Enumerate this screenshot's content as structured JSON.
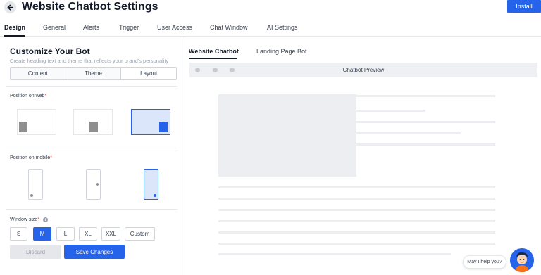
{
  "header": {
    "title": "Website Chatbot Settings",
    "install_label": "Install"
  },
  "tabs": [
    {
      "label": "Design",
      "active": true
    },
    {
      "label": "General"
    },
    {
      "label": "Alerts"
    },
    {
      "label": "Trigger"
    },
    {
      "label": "User Access"
    },
    {
      "label": "Chat Window"
    },
    {
      "label": "AI Settings"
    }
  ],
  "customize": {
    "title": "Customize Your Bot",
    "subtitle": "Create heading text and theme that reflects your brand's personality",
    "segments": [
      "Content",
      "Theme",
      "Layout"
    ],
    "selected_segment": "Layout"
  },
  "position_web": {
    "label": "Position on web",
    "required_mark": "*",
    "options": [
      "bottom-left",
      "bottom-center",
      "bottom-right"
    ],
    "selected": "bottom-right"
  },
  "position_mobile": {
    "label": "Position on mobile",
    "required_mark": "*",
    "options": [
      "bottom-left",
      "center-right",
      "bottom-right"
    ],
    "selected": "bottom-right"
  },
  "window_size": {
    "label": "Window size",
    "required_mark": "*",
    "info_glyph": "i",
    "sizes": [
      "S",
      "M",
      "L",
      "XL",
      "XXL",
      "Custom"
    ],
    "selected": "M"
  },
  "actions": {
    "discard_label": "Discard",
    "save_label": "Save Changes"
  },
  "preview": {
    "tabs": [
      {
        "label": "Website Chatbot",
        "active": true
      },
      {
        "label": "Landing Page Bot"
      }
    ],
    "bar_title": "Chatbot Preview"
  },
  "help": {
    "bubble_text": "May I help you?"
  },
  "colors": {
    "accent": "#2563eb",
    "selected_bg": "#dbe6fb",
    "placeholder": "#eceef1"
  }
}
